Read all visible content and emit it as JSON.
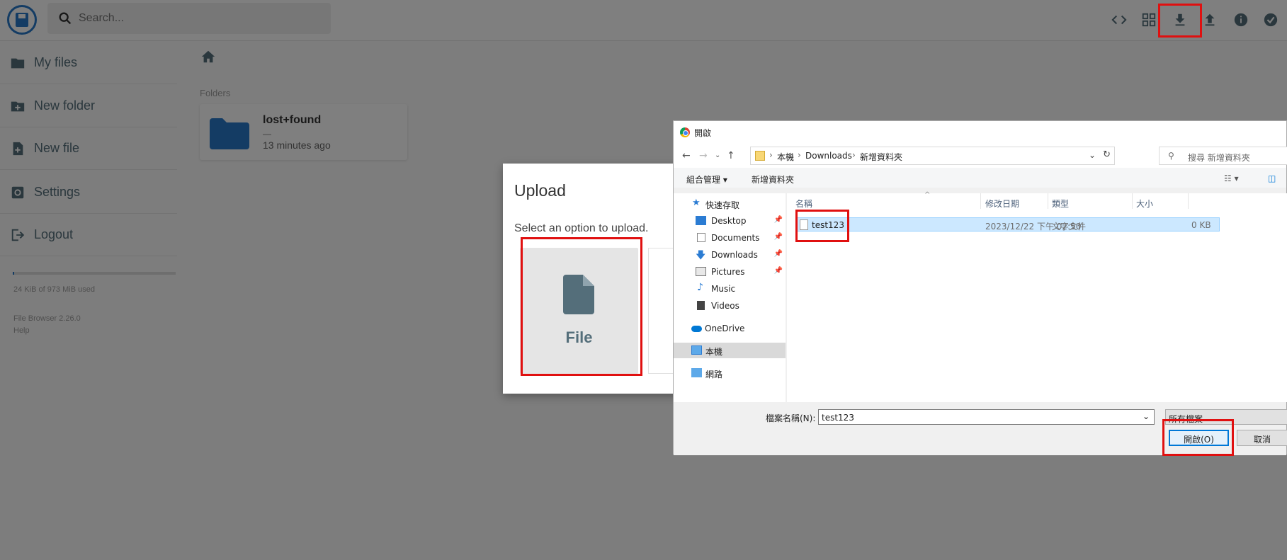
{
  "header": {
    "search_placeholder": "Search...",
    "buttons": [
      "code-view",
      "grid-view",
      "download",
      "upload",
      "info",
      "select"
    ]
  },
  "sidebar": {
    "items": [
      {
        "label": "My files",
        "icon": "folder-icon"
      },
      {
        "label": "New folder",
        "icon": "new-folder-icon"
      },
      {
        "label": "New file",
        "icon": "new-file-icon"
      },
      {
        "label": "Settings",
        "icon": "settings-icon"
      },
      {
        "label": "Logout",
        "icon": "logout-icon"
      }
    ],
    "usage": "24 KiB of 973 MiB used",
    "usage_fraction": 0.01,
    "version": "File Browser 2.26.0",
    "help": "Help"
  },
  "main": {
    "folders_label": "Folders",
    "folder": {
      "name": "lost+found",
      "size": "—",
      "modified": "13 minutes ago"
    }
  },
  "upload_modal": {
    "title": "Upload",
    "description": "Select an option to upload.",
    "option_file": "File"
  },
  "file_dialog": {
    "title": "開啟",
    "breadcrumb": [
      "本機",
      "Downloads",
      "新增資料夾"
    ],
    "search_placeholder": "搜尋 新增資料夾",
    "toolbar": {
      "organize": "組合管理 ▾",
      "new_folder": "新增資料夾"
    },
    "nav": [
      {
        "label": "快速存取",
        "icon": "star-icon"
      },
      {
        "label": "Desktop",
        "icon": "desktop-icon",
        "pinned": true
      },
      {
        "label": "Documents",
        "icon": "documents-icon",
        "pinned": true
      },
      {
        "label": "Downloads",
        "icon": "downloads-icon",
        "pinned": true
      },
      {
        "label": "Pictures",
        "icon": "pictures-icon",
        "pinned": true
      },
      {
        "label": "Music",
        "icon": "music-icon"
      },
      {
        "label": "Videos",
        "icon": "videos-icon"
      },
      {
        "label": "OneDrive",
        "icon": "cloud-icon"
      },
      {
        "label": "本機",
        "icon": "computer-icon",
        "selected": true
      },
      {
        "label": "網路",
        "icon": "network-icon"
      }
    ],
    "columns": [
      "名稱",
      "修改日期",
      "類型",
      "大小"
    ],
    "files": [
      {
        "name": "test123",
        "modified": "2023/12/22 下午 02:50",
        "type": "文字文件",
        "size": "0 KB"
      }
    ],
    "filename_label": "檔案名稱(N):",
    "filename_value": "test123",
    "filetype_value": "所有檔案",
    "open_button": "開啟(O)",
    "cancel_button": "取消"
  }
}
